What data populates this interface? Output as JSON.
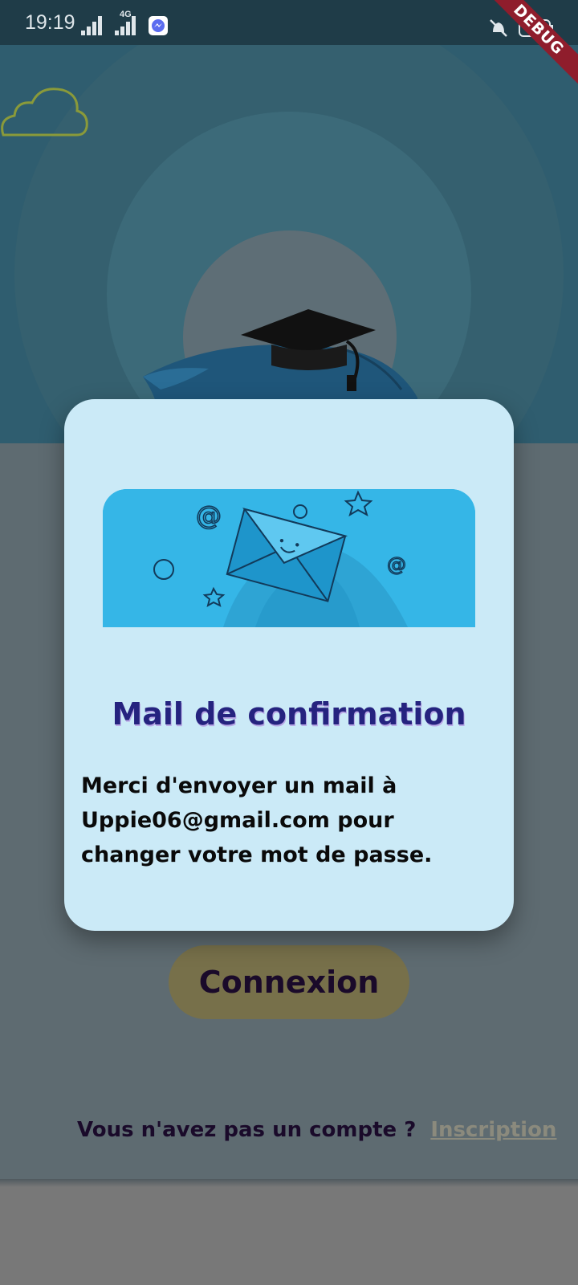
{
  "status_bar": {
    "time": "19:19",
    "network_label": "4G",
    "debug_label": "DEBUG"
  },
  "login_screen": {
    "login_button": "Connexion",
    "no_account_question": "Vous n'avez pas un compte ?",
    "signup_link": "Inscription"
  },
  "dialog": {
    "title": "Mail de confirmation",
    "message": "Merci d'envoyer un mail à Uppie06@gmail.com pour changer votre mot de passe."
  },
  "colors": {
    "dialog_background": "#cbeaf7",
    "title_color": "#25237f",
    "login_button": "#77704a",
    "illustration_blue": "#35b6e7"
  }
}
